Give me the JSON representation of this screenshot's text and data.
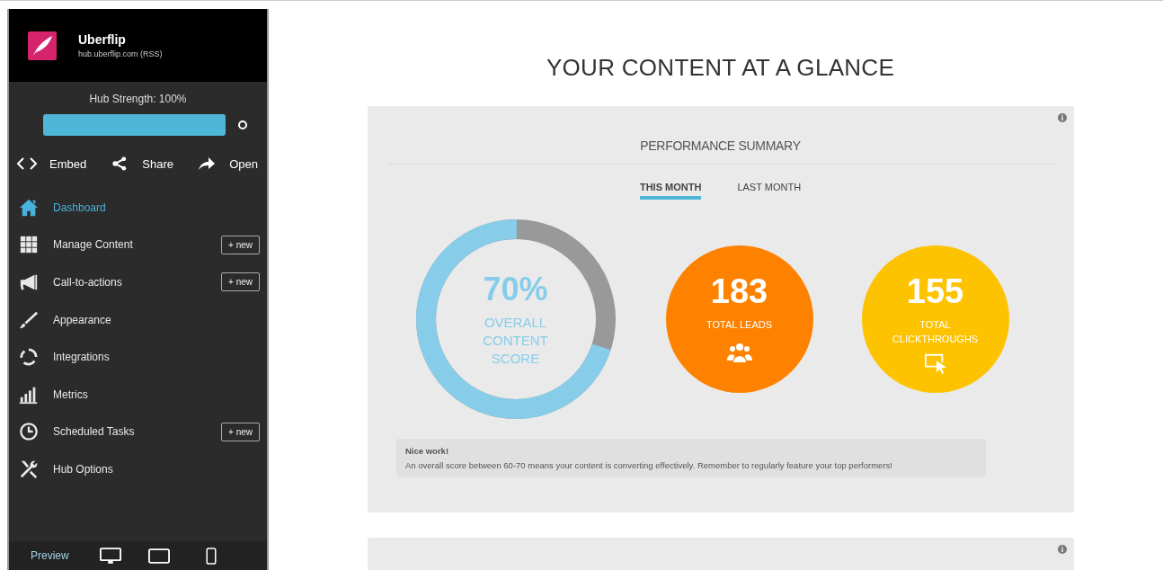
{
  "hub": {
    "name": "Uberflip",
    "url": "hub.uberflip.com (RSS)"
  },
  "hub_strength": {
    "label": "Hub Strength: 100%",
    "level": 1
  },
  "actions": [
    {
      "label": "Embed"
    },
    {
      "label": "Share"
    },
    {
      "label": "Open"
    }
  ],
  "nav": [
    {
      "label": "Dashboard",
      "selected": true
    },
    {
      "label": "Manage Content",
      "selected": false,
      "button": "+ new"
    },
    {
      "label": "Call-to-actions",
      "selected": false,
      "button": "+ new"
    },
    {
      "label": "Appearance",
      "selected": false
    },
    {
      "label": "Integrations",
      "selected": false
    },
    {
      "label": "Metrics",
      "selected": false
    },
    {
      "label": "Scheduled Tasks",
      "selected": false,
      "button": "+ new"
    },
    {
      "label": "Hub Options",
      "selected": false
    }
  ],
  "preview": {
    "label": "Preview"
  },
  "page_title": "YOUR CONTENT AT A GLANCE",
  "summary": {
    "title": "PERFORMANCE SUMMARY",
    "tabs": [
      {
        "label": "THIS MONTH",
        "selected": true
      },
      {
        "label": "LAST MONTH",
        "selected": false
      }
    ],
    "score": {
      "value": "70%",
      "label": "OVERALL CONTENT SCORE",
      "level": 0.7
    },
    "stats": [
      {
        "value": "183",
        "label": "TOTAL LEADS",
        "color": "#fe8200"
      },
      {
        "value": "155",
        "label": "TOTAL CLICKTHROUGHS",
        "color": "#fdc300"
      }
    ],
    "note": {
      "title": "Nice work!",
      "text": "An overall score between 60-70 means your content is converting effectively. Remember to regularly feature your top performers!"
    }
  }
}
